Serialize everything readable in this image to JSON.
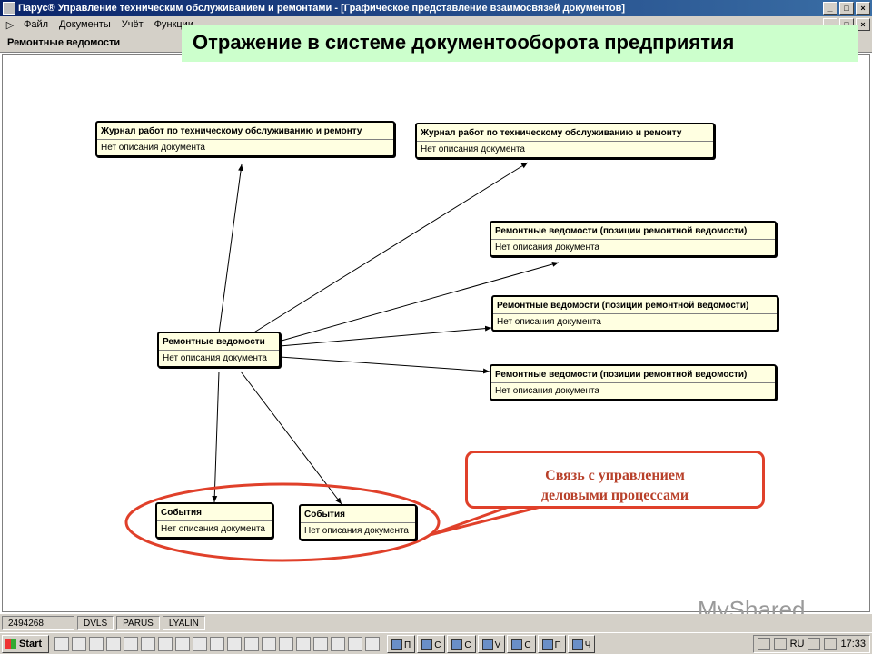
{
  "window": {
    "title": "Парус® Управление техническим обслуживанием и ремонтами - [Графическое представление взаимосвязей документов]"
  },
  "menu": [
    "Файл",
    "Документы",
    "Учёт",
    "Функции"
  ],
  "doc_header": "Ремонтные ведомости",
  "banner": "Отражение в системе документооборота предприятия",
  "nodes": [
    {
      "title": "Журнал работ по техническому обслуживанию и ремонту",
      "desc": "Нет описания документа"
    },
    {
      "title": "Журнал работ по техническому обслуживанию и ремонту",
      "desc": "Нет описания документа"
    },
    {
      "title": "Ремонтные ведомости (позиции ремонтной ведомости)",
      "desc": "Нет описания документа"
    },
    {
      "title": "Ремонтные ведомости (позиции ремонтной ведомости)",
      "desc": "Нет описания документа"
    },
    {
      "title": "Ремонтные ведомости (позиции ремонтной ведомости)",
      "desc": "Нет описания документа"
    },
    {
      "title": "Ремонтные ведомости",
      "desc": "Нет описания документа"
    },
    {
      "title": "События",
      "desc": "Нет описания документа"
    },
    {
      "title": "События",
      "desc": "Нет описания документа"
    }
  ],
  "callout": {
    "line1": "Связь с управлением",
    "line2": "деловыми процессами"
  },
  "status": [
    "2494268",
    "DVLS",
    "PARUS",
    "LYALIN"
  ],
  "taskbar": {
    "start": "Start",
    "tasks": [
      "П",
      "С",
      "С",
      "V",
      "С",
      "П",
      "Ч"
    ],
    "clock": "17:33",
    "lang": "RU"
  },
  "watermark": "MyShared",
  "colors": {
    "banner": "#ccffcc",
    "node_fill": "#ffffe1",
    "callout": "#e0402a",
    "titlebar": "#0a246a"
  }
}
